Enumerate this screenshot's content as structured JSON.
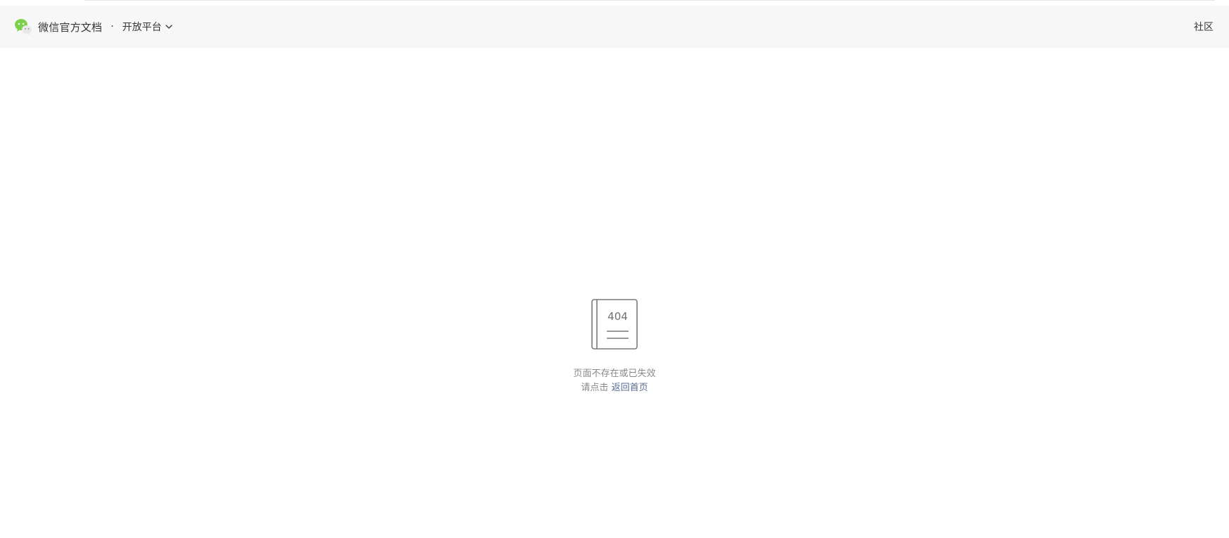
{
  "header": {
    "brand_title": "微信官方文档",
    "separator": "·",
    "platform_label": "开放平台",
    "community_label": "社区"
  },
  "not_found": {
    "code": "404",
    "message": "页面不存在或已失效",
    "prompt": "请点击",
    "home_link_label": "返回首页"
  },
  "icons": {
    "logo": "wechat-logo-icon",
    "chevron": "chevron-down-icon",
    "illustration": "book-404-icon"
  },
  "colors": {
    "header_bg": "#f7f7f7",
    "text_primary": "#353535",
    "text_secondary": "#888888",
    "link": "#576b95",
    "wechat_green": "#7bd14a"
  }
}
